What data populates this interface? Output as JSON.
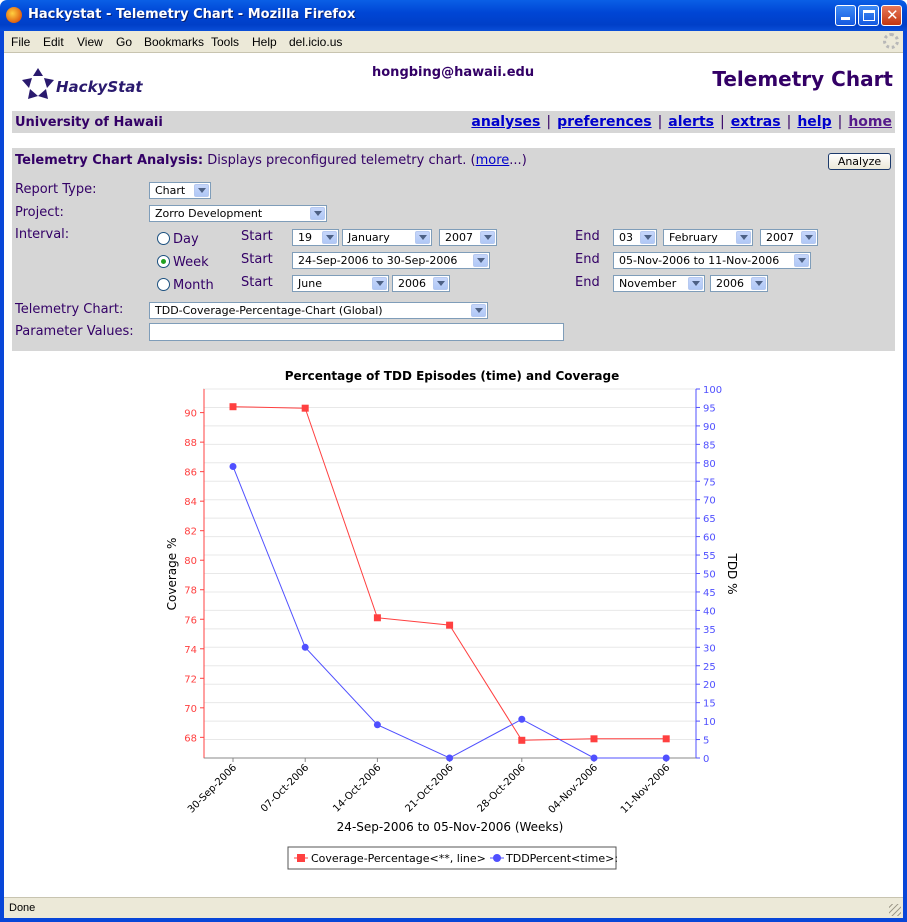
{
  "window": {
    "title": "Hackystat - Telemetry Chart - Mozilla Firefox"
  },
  "menu": [
    "File",
    "Edit",
    "View",
    "Go",
    "Bookmarks",
    "Tools",
    "Help",
    "del.icio.us"
  ],
  "status": "Done",
  "header": {
    "logo_text": "HackyStat",
    "user_email": "hongbing@hawaii.edu",
    "page_title": "Telemetry Chart",
    "org": "University of Hawaii",
    "nav": [
      {
        "label": "analyses"
      },
      {
        "label": "preferences"
      },
      {
        "label": "alerts"
      },
      {
        "label": "extras"
      },
      {
        "label": "help"
      },
      {
        "label": "home"
      }
    ]
  },
  "form": {
    "analysis_title": "Telemetry Chart Analysis:",
    "analysis_desc": "Displays preconfigured telemetry chart. (",
    "more_label": "more",
    "more_tail": "...)",
    "analyze_label": "Analyze",
    "report_type_label": "Report Type:",
    "report_type_value": "Chart",
    "project_label": "Project:",
    "project_value": "Zorro Development",
    "interval_label": "Interval:",
    "day_label": "Day",
    "week_label": "Week",
    "month_label": "Month",
    "start_label": "Start",
    "end_label": "End",
    "day_start": {
      "day": "19",
      "month": "January",
      "year": "2007"
    },
    "day_end": {
      "day": "03",
      "month": "February",
      "year": "2007"
    },
    "week_start": "24-Sep-2006 to 30-Sep-2006",
    "week_end": "05-Nov-2006 to 11-Nov-2006",
    "month_start": {
      "month": "June",
      "year": "2006"
    },
    "month_end": {
      "month": "November",
      "year": "2006"
    },
    "selected_interval": "Week",
    "telemetry_chart_label": "Telemetry Chart:",
    "telemetry_chart_value": "TDD-Coverage-Percentage-Chart (Global)",
    "parameter_values_label": "Parameter Values:",
    "parameter_values_value": ""
  },
  "chart_data": {
    "type": "line",
    "title": "Percentage of TDD Episodes (time) and Coverage",
    "xlabel": "24-Sep-2006 to 05-Nov-2006 (Weeks)",
    "ylabel": "Coverage %",
    "y2label": "TDD %",
    "categories": [
      "30-Sep-2006",
      "07-Oct-2006",
      "14-Oct-2006",
      "21-Oct-2006",
      "28-Oct-2006",
      "04-Nov-2006",
      "11-Nov-2006"
    ],
    "ylim": [
      66.6,
      91.6
    ],
    "y_ticks": [
      68,
      70,
      72,
      74,
      76,
      78,
      80,
      82,
      84,
      86,
      88,
      90
    ],
    "y2lim": [
      0,
      100
    ],
    "y2_ticks": [
      0,
      5,
      10,
      15,
      20,
      25,
      30,
      35,
      40,
      45,
      50,
      55,
      60,
      65,
      70,
      75,
      80,
      85,
      90,
      95,
      100
    ],
    "series": [
      {
        "name": "Coverage-Percentage<**, line>",
        "axis": "left",
        "color": "#ff4040",
        "marker": "square",
        "values": [
          90.4,
          90.3,
          76.1,
          75.6,
          67.8,
          67.9,
          67.9
        ]
      },
      {
        "name": "TDDPercent<time>:",
        "axis": "right",
        "color": "#5050ff",
        "marker": "circle",
        "values": [
          79,
          30,
          9,
          0,
          10.5,
          0,
          0
        ]
      }
    ],
    "grid": true,
    "legend": "bottom"
  }
}
